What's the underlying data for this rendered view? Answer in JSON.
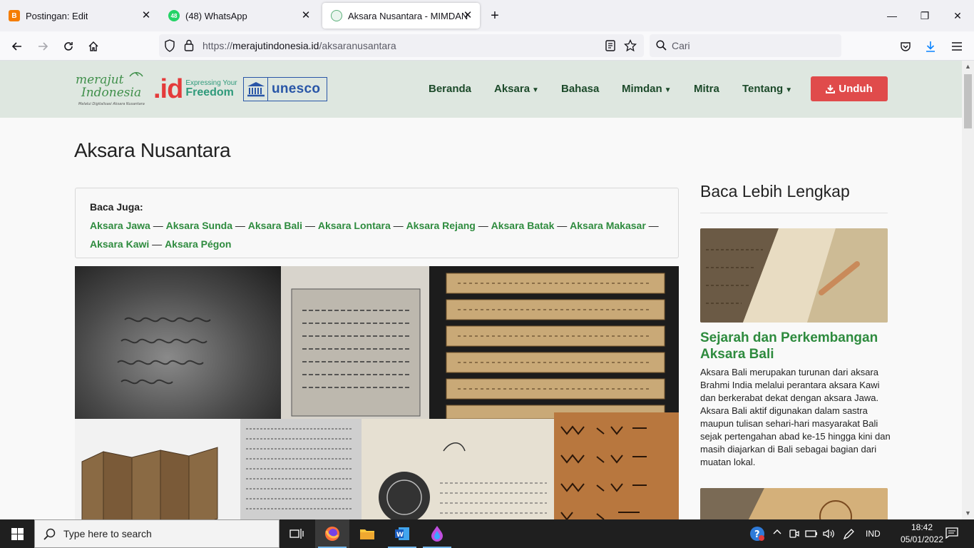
{
  "browser": {
    "tabs": [
      {
        "title": "Postingan: Edit",
        "favicon": "blogger-icon",
        "active": false
      },
      {
        "title": "(48) WhatsApp",
        "favicon": "whatsapp-icon",
        "badge": "48",
        "active": false
      },
      {
        "title": "Aksara Nusantara - MIMDAN",
        "favicon": "mimdan-icon",
        "active": true
      }
    ],
    "url_prefix": "https://",
    "url_host": "merajutindonesia.id",
    "url_path": "/aksaranusantara",
    "search_placeholder": "Cari"
  },
  "site": {
    "logo_merajut_line1": "merajut",
    "logo_merajut_line2": "Indonesia",
    "logo_merajut_caption": "Melalui Digitalisasi Aksara Nusantara",
    "logo_id_text": ".id",
    "logo_id_tag1": "Expressing Your",
    "logo_id_tag2": "Freedom",
    "logo_unesco": "unesco",
    "menu": [
      {
        "label": "Beranda",
        "dropdown": false
      },
      {
        "label": "Aksara",
        "dropdown": true
      },
      {
        "label": "Bahasa",
        "dropdown": false
      },
      {
        "label": "Mimdan",
        "dropdown": true
      },
      {
        "label": "Mitra",
        "dropdown": false
      },
      {
        "label": "Tentang",
        "dropdown": true
      }
    ],
    "download_label": "Unduh",
    "colors": {
      "header_bg": "#dee7e0",
      "accent_green": "#2e8b3e",
      "download_red": "#e04b4b"
    }
  },
  "content": {
    "page_title": "Aksara Nusantara",
    "baca_juga_label": "Baca Juga:",
    "separator": "—",
    "baca_juga_links": [
      "Aksara Jawa",
      "Aksara Sunda",
      "Aksara Bali",
      "Aksara Lontara",
      "Aksara Rejang",
      "Aksara Batak",
      "Aksara Makasar",
      "Aksara Kawi",
      "Aksara Pégon"
    ]
  },
  "sidebar": {
    "title": "Baca Lebih Lengkap",
    "article_title": "Sejarah dan Perkembangan Aksara Bali",
    "article_text": "Aksara Bali merupakan turunan dari aksara Brahmi India melalui perantara aksara Kawi dan berkerabat dekat dengan aksara Jawa. Aksara Bali aktif digunakan dalam sastra maupun tulisan sehari-hari masyarakat Bali sejak pertengahan abad ke-15 hingga kini dan masih diajarkan di Bali sebagai bagian dari muatan lokal."
  },
  "taskbar": {
    "search_placeholder": "Type here to search",
    "language": "IND",
    "time": "18:42",
    "date": "05/01/2022",
    "apps": [
      "task-view-icon",
      "firefox-icon",
      "file-explorer-icon",
      "word-icon",
      "edge-drop-icon"
    ]
  }
}
